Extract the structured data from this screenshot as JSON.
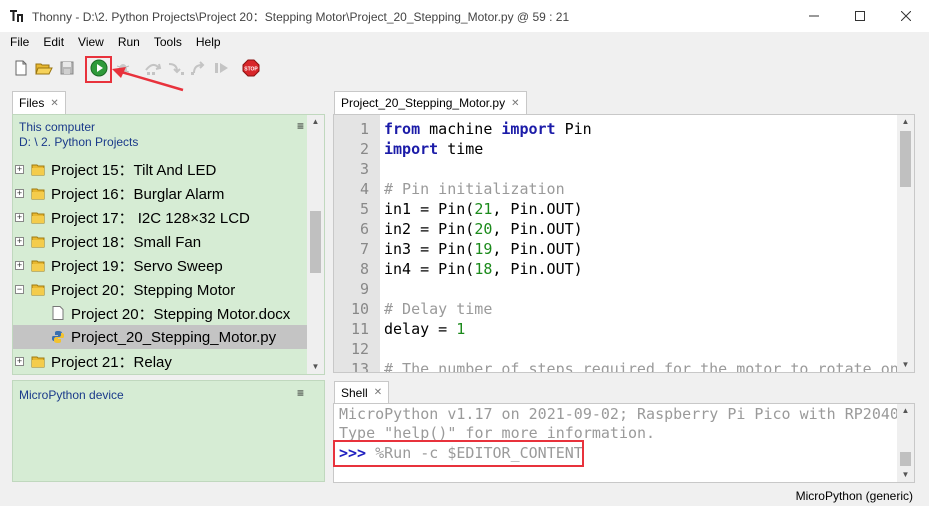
{
  "window": {
    "title": "Thonny  -  D:\\2. Python Projects\\Project 20：Stepping Motor\\Project_20_Stepping_Motor.py  @  59 : 21"
  },
  "menu": [
    "File",
    "Edit",
    "View",
    "Run",
    "Tools",
    "Help"
  ],
  "toolbar": {
    "icons": [
      "new-file-icon",
      "open-file-icon",
      "save-icon",
      "run-icon",
      "debug-icon",
      "step-over-icon",
      "step-into-icon",
      "step-out-icon",
      "resume-icon",
      "stop-icon"
    ],
    "stop_label": "STOP"
  },
  "files": {
    "tab_label": "Files",
    "location_label": "This computer",
    "location_path": "D: \\ 2. Python Projects",
    "menu_glyph": "≡",
    "items": [
      {
        "label": "Project 15：Tilt And LED",
        "type": "folder",
        "expander": "+"
      },
      {
        "label": "Project 16：Burglar Alarm",
        "type": "folder",
        "expander": "+"
      },
      {
        "label": "Project 17： I2C 128×32 LCD",
        "type": "folder",
        "expander": "+"
      },
      {
        "label": "Project 18：Small Fan",
        "type": "folder",
        "expander": "+"
      },
      {
        "label": "Project 19：Servo Sweep",
        "type": "folder",
        "expander": "+"
      },
      {
        "label": "Project 20：Stepping Motor",
        "type": "folder",
        "expander": "−"
      },
      {
        "label": "Project 20：Stepping Motor.docx",
        "type": "doc",
        "expander": ""
      },
      {
        "label": "Project_20_Stepping_Motor.py",
        "type": "python",
        "expander": "",
        "selected": true
      },
      {
        "label": "Project 21：Relay",
        "type": "folder",
        "expander": "+"
      }
    ]
  },
  "device": {
    "title": "MicroPython device",
    "menu_glyph": "≡"
  },
  "editor": {
    "tab_label": "Project_20_Stepping_Motor.py",
    "lines": [
      {
        "n": "1",
        "parts": [
          {
            "t": "from",
            "c": "kw"
          },
          {
            "t": " machine ",
            "c": ""
          },
          {
            "t": "import",
            "c": "kw"
          },
          {
            "t": " Pin",
            "c": ""
          }
        ]
      },
      {
        "n": "2",
        "parts": [
          {
            "t": "import",
            "c": "kw"
          },
          {
            "t": " time",
            "c": ""
          }
        ]
      },
      {
        "n": "3",
        "parts": []
      },
      {
        "n": "4",
        "parts": [
          {
            "t": "# Pin initialization",
            "c": "cmt"
          }
        ]
      },
      {
        "n": "5",
        "parts": [
          {
            "t": "in1 = Pin(",
            "c": ""
          },
          {
            "t": "21",
            "c": "num"
          },
          {
            "t": ", Pin.OUT)",
            "c": ""
          }
        ]
      },
      {
        "n": "6",
        "parts": [
          {
            "t": "in2 = Pin(",
            "c": ""
          },
          {
            "t": "20",
            "c": "num"
          },
          {
            "t": ", Pin.OUT)",
            "c": ""
          }
        ]
      },
      {
        "n": "7",
        "parts": [
          {
            "t": "in3 = Pin(",
            "c": ""
          },
          {
            "t": "19",
            "c": "num"
          },
          {
            "t": ", Pin.OUT)",
            "c": ""
          }
        ]
      },
      {
        "n": "8",
        "parts": [
          {
            "t": "in4 = Pin(",
            "c": ""
          },
          {
            "t": "18",
            "c": "num"
          },
          {
            "t": ", Pin.OUT)",
            "c": ""
          }
        ]
      },
      {
        "n": "9",
        "parts": []
      },
      {
        "n": "10",
        "parts": [
          {
            "t": "# Delay time",
            "c": "cmt"
          }
        ]
      },
      {
        "n": "11",
        "parts": [
          {
            "t": "delay = ",
            "c": ""
          },
          {
            "t": "1",
            "c": "num"
          }
        ]
      },
      {
        "n": "12",
        "parts": []
      },
      {
        "n": "13",
        "parts": [
          {
            "t": "# The number of steps required for the motor to rotate on",
            "c": "cmt"
          }
        ]
      }
    ]
  },
  "shell": {
    "tab_label": "Shell",
    "banner1": "MicroPython v1.17 on 2021-09-02; Raspberry Pi Pico with RP2040",
    "banner2": "Type \"help()\" for more information.",
    "prompt": ">>>",
    "command": " %Run -c $EDITOR_CONTENT"
  },
  "status": {
    "interpreter": "MicroPython (generic)"
  },
  "colors": {
    "panel_green": "#d6ecd4",
    "highlight_red": "#e8323c",
    "keyword": "#1b1ba8",
    "number": "#1b8a1b",
    "comment": "#9a9a9a"
  }
}
